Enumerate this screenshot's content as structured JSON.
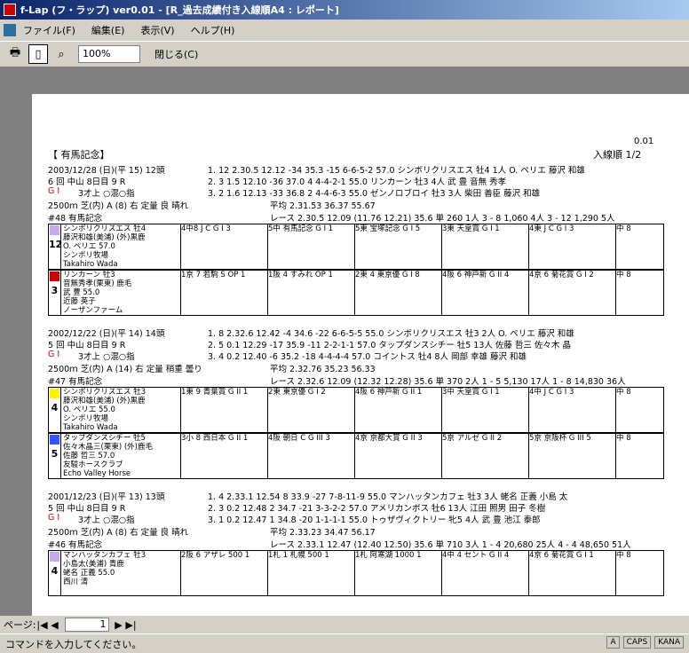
{
  "window": {
    "title": "f-Lap (フ・ラップ) ver0.01 - [R_過去成績付き入線順A4 : レポート]"
  },
  "menu": [
    "ファイル(F)",
    "編集(E)",
    "表示(V)",
    "ヘルプ(H)"
  ],
  "toolbar": {
    "zoom": "100%",
    "close": "閉じる(C)"
  },
  "report": {
    "page": "0.01",
    "title": "【 有馬記念】",
    "order": "入線順 1/2"
  },
  "races": [
    {
      "date": "2003/12/28 (日)(平 15)",
      "heads": "12頭",
      "place": "6 回 中山 8日目 9 R",
      "grade": "G I",
      "age": "3才上",
      "cond": "○混○指",
      "dist": "2500ｍ 芝(内)",
      "track": "A (8) 右 定量",
      "going": "良 晴れ",
      "avg": "平均",
      "avgtime": "2.31.53",
      "t1": "36.37",
      "t2": "55.67",
      "label": "#48 有馬記念",
      "lap": "レース 2.30.5 12.09 (11.76 12.21) 35.6 単 260 1人 3 - 8 1,060 4人 3 - 12 1,290 5人",
      "results": [
        "1. 12 2.30.5 12.12 -34 35.3 -15 6-6-5-2 57.0 シンボリクリスエス 牡4 1人 O. ペリエ 藤沢 和雄",
        "2. 3 1.5 12.10 -36 37.0 4 4-4-2-1 55.0 リンカーン 牡3 4人 武 豊 音無 秀孝",
        "3. 2 1.6 12.13 -33 36.8 2 4-4-6-3 55.0 ゼンノロブロイ 牡3 3人 柴田 善臣 藤沢 和雄"
      ],
      "horses": [
        {
          "num": "12",
          "name": "シンボリクリスエス 牡4",
          "trainer": "藤沢和雄(美浦) (外)黒鹿",
          "jockey": "O. ペリエ 57.0",
          "owner": "シンボリ牧場",
          "breeder": "Takahiro Wada",
          "past": [
            "4中8 J C G I 3",
            "5中 有馬記念 G I 1",
            "5東 宝塚記念 G I 5",
            "3東 天皇賞 G I 1",
            "4東 J C G I 3",
            "中 8"
          ]
        },
        {
          "num": "3",
          "name": "リンカーン 牡3",
          "trainer": "音無秀孝(栗東) 鹿毛",
          "jockey": "武 豊 55.0",
          "owner": "近藤 英子",
          "breeder": "ノーザンファーム",
          "past": [
            "1京 7 若駒 S OP 1",
            "1阪 4 すみれ OP 1",
            "2東 4 東京優 G I 8",
            "4阪 6 神戸新 G II 4",
            "4京 6 菊花賞 G I 2",
            "中 8"
          ]
        }
      ]
    },
    {
      "date": "2002/12/22 (日)(平 14)",
      "heads": "14頭",
      "place": "5 回 中山 8日目 9 R",
      "grade": "G I",
      "age": "3才上",
      "cond": "○混○指",
      "dist": "2500ｍ 芝(内)",
      "track": "A (14) 右 定量",
      "going": "稍重 曇り",
      "avg": "平均",
      "avgtime": "2.32.76",
      "t1": "35.23",
      "t2": "56.33",
      "label": "#47 有馬記念",
      "lap": "レース 2.32.6 12.09 (12.32 12.28) 35.6 単 370 2人 1 - 5 5,130 17人 1 - 8 14,830 36人",
      "results": [
        "1. 8 2.32.6 12.42 -4 34.6 -22 6-6-5-5 55.0 シンボリクリスエス 牡3 2人 O. ペリエ 藤沢 和雄",
        "2. 5 0.1 12.29 -17 35.9 -11 2-2-1-1 57.0 タップダンスシチー 牡5 13人 佐藤 哲三 佐々木 晶",
        "3. 4 0.2 12.40 -6 35.2 -18 4-4-4-4 57.0 コイントス 牡4 8人 岡部 幸雄 藤沢 和雄"
      ],
      "horses": [
        {
          "num": "4",
          "name": "シンボリクリスエス 牡3",
          "trainer": "藤沢和雄(美浦) (外)黒鹿",
          "jockey": "O. ペリエ 55.0",
          "owner": "シンボリ牧場",
          "breeder": "Takahiro Wada",
          "past": [
            "1東 9 青葉賞 G II 1",
            "2東 東京優 G I 2",
            "4阪 6 神戸新 G II 1",
            "3中 天皇賞 G I 1",
            "4中 J C G I 3",
            "中 8"
          ]
        },
        {
          "num": "5",
          "name": "タップダンスシチー 牡5",
          "trainer": "佐々木晶三(栗東) (外)鹿毛",
          "jockey": "佐藤 哲三 57.0",
          "owner": "友駿ホースクラブ",
          "breeder": "Echo Valley Horse",
          "past": [
            "3小 8 西日本 G II 1",
            "4阪 朝日 C G III 3",
            "4京 京都大賞 G II 3",
            "5京 アルゼ G II 2",
            "5京 京阪杯 G III 5",
            "中 8"
          ]
        }
      ]
    },
    {
      "date": "2001/12/23 (日)(平 13)",
      "heads": "13頭",
      "place": "5 回 中山 8日目 9 R",
      "grade": "G I",
      "age": "3才上",
      "cond": "○混○指",
      "dist": "2500ｍ 芝(内)",
      "track": "A (8) 右 定量",
      "going": "良 晴れ",
      "avg": "平均",
      "avgtime": "2.33.23",
      "t1": "34.47",
      "t2": "56.17",
      "label": "#46 有馬記念",
      "lap": "レース 2.33.1 12.47 (12.40 12.50) 35.6 単 710 3人 1 - 4 20,680 25人 4 - 4 48,650 51人",
      "results": [
        "1. 4 2.33.1 12.54 8 33.9 -27 7-8-11-9 55.0 マンハッタンカフェ 牡3 3人 蛯名 正義 小島 太",
        "2. 3 0.2 12.48 2 34.7 -21 3-3-2-2 57.0 アメリカンボス 牡6 13人 江田 照男 田子 冬樹",
        "3. 1 0.2 12.47 1 34.8 -20 1-1-1-1 55.0 トゥザヴィクトリー 牝5 4人 武 豊 池江 泰郎"
      ],
      "horses": [
        {
          "num": "4",
          "name": "マンハッタンカフェ 牡3",
          "trainer": "小島太(美浦) 青鹿",
          "jockey": "蛯名 正義 55.0",
          "owner": "西川 清",
          "breeder": "",
          "past": [
            "2阪 6 アザレ 500 1",
            "1札 1 札幌 500 1",
            "1札 阿寒湖 1000 1",
            "4中 4 セント G II 4",
            "4京 6 菊花賞 G I 1",
            "中 8"
          ]
        }
      ]
    }
  ]
}
